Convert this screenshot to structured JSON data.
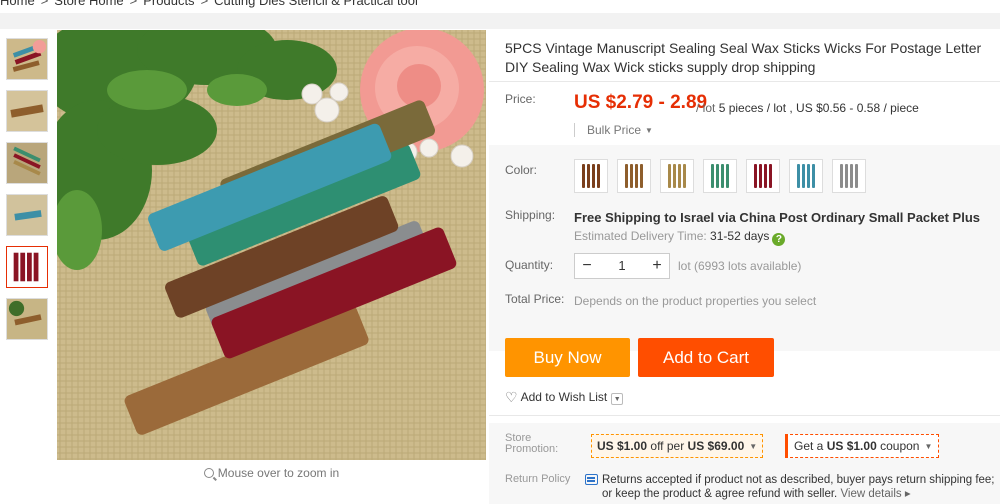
{
  "breadcrumb": {
    "items": [
      "Home",
      "Store Home",
      "Products",
      "Cutting Dies Stencil & Practical tool"
    ],
    "separator": ">"
  },
  "gallery": {
    "thumbnail_count": 6,
    "zoom_hint": "Mouse over to zoom in"
  },
  "product": {
    "title": "5PCS Vintage Manuscript Sealing Seal Wax Sticks Wicks For Postage Letter DIY Sealing Wax Wick sticks supply drop shipping"
  },
  "price": {
    "label": "Price:",
    "range": "US $2.79 - 2.89",
    "per_lot_prefix": "/ lot",
    "lot_detail": "5 pieces / lot , US $0.56 - 0.58 / piece",
    "bulk_label": "Bulk Price"
  },
  "color": {
    "label": "Color:",
    "options": [
      {
        "name": "brown",
        "hex": "#7a3f1c"
      },
      {
        "name": "bronze",
        "hex": "#8e5e2c"
      },
      {
        "name": "gold",
        "hex": "#a8894a"
      },
      {
        "name": "green",
        "hex": "#3b8e6e"
      },
      {
        "name": "burgundy",
        "hex": "#8a1424"
      },
      {
        "name": "teal",
        "hex": "#3d8fa6"
      },
      {
        "name": "silver",
        "hex": "#8c8c8c"
      }
    ]
  },
  "shipping": {
    "label": "Shipping:",
    "method": "Free Shipping to Israel via China Post Ordinary Small Packet Plus",
    "estimate_label": "Estimated Delivery Time:",
    "estimate_days": "31-52 days",
    "help_icon": "?"
  },
  "quantity": {
    "label": "Quantity:",
    "minus": "−",
    "value": "1",
    "plus": "+",
    "availability": "lot (6993 lots available)"
  },
  "total": {
    "label": "Total Price:",
    "value": "Depends on the product properties you select"
  },
  "actions": {
    "buy_now": "Buy Now",
    "add_to_cart": "Add to Cart",
    "wish_list": "Add to Wish List"
  },
  "promotion": {
    "label": "Store Promotion:",
    "offer_amount": "US $1.00",
    "offer_mid": "off per",
    "offer_threshold": "US $69.00",
    "coupon_prefix": "Get a",
    "coupon_amount": "US $1.00",
    "coupon_suffix": "coupon"
  },
  "return_policy": {
    "label": "Return Policy",
    "text": "Returns accepted if product not as described, buyer pays return shipping fee; or keep the product & agree refund with seller.",
    "link": "View details ▸"
  },
  "colors": {
    "accent_red": "#e62e04",
    "buy_now": "#ff9400",
    "add_to_cart": "#ff4e00"
  }
}
